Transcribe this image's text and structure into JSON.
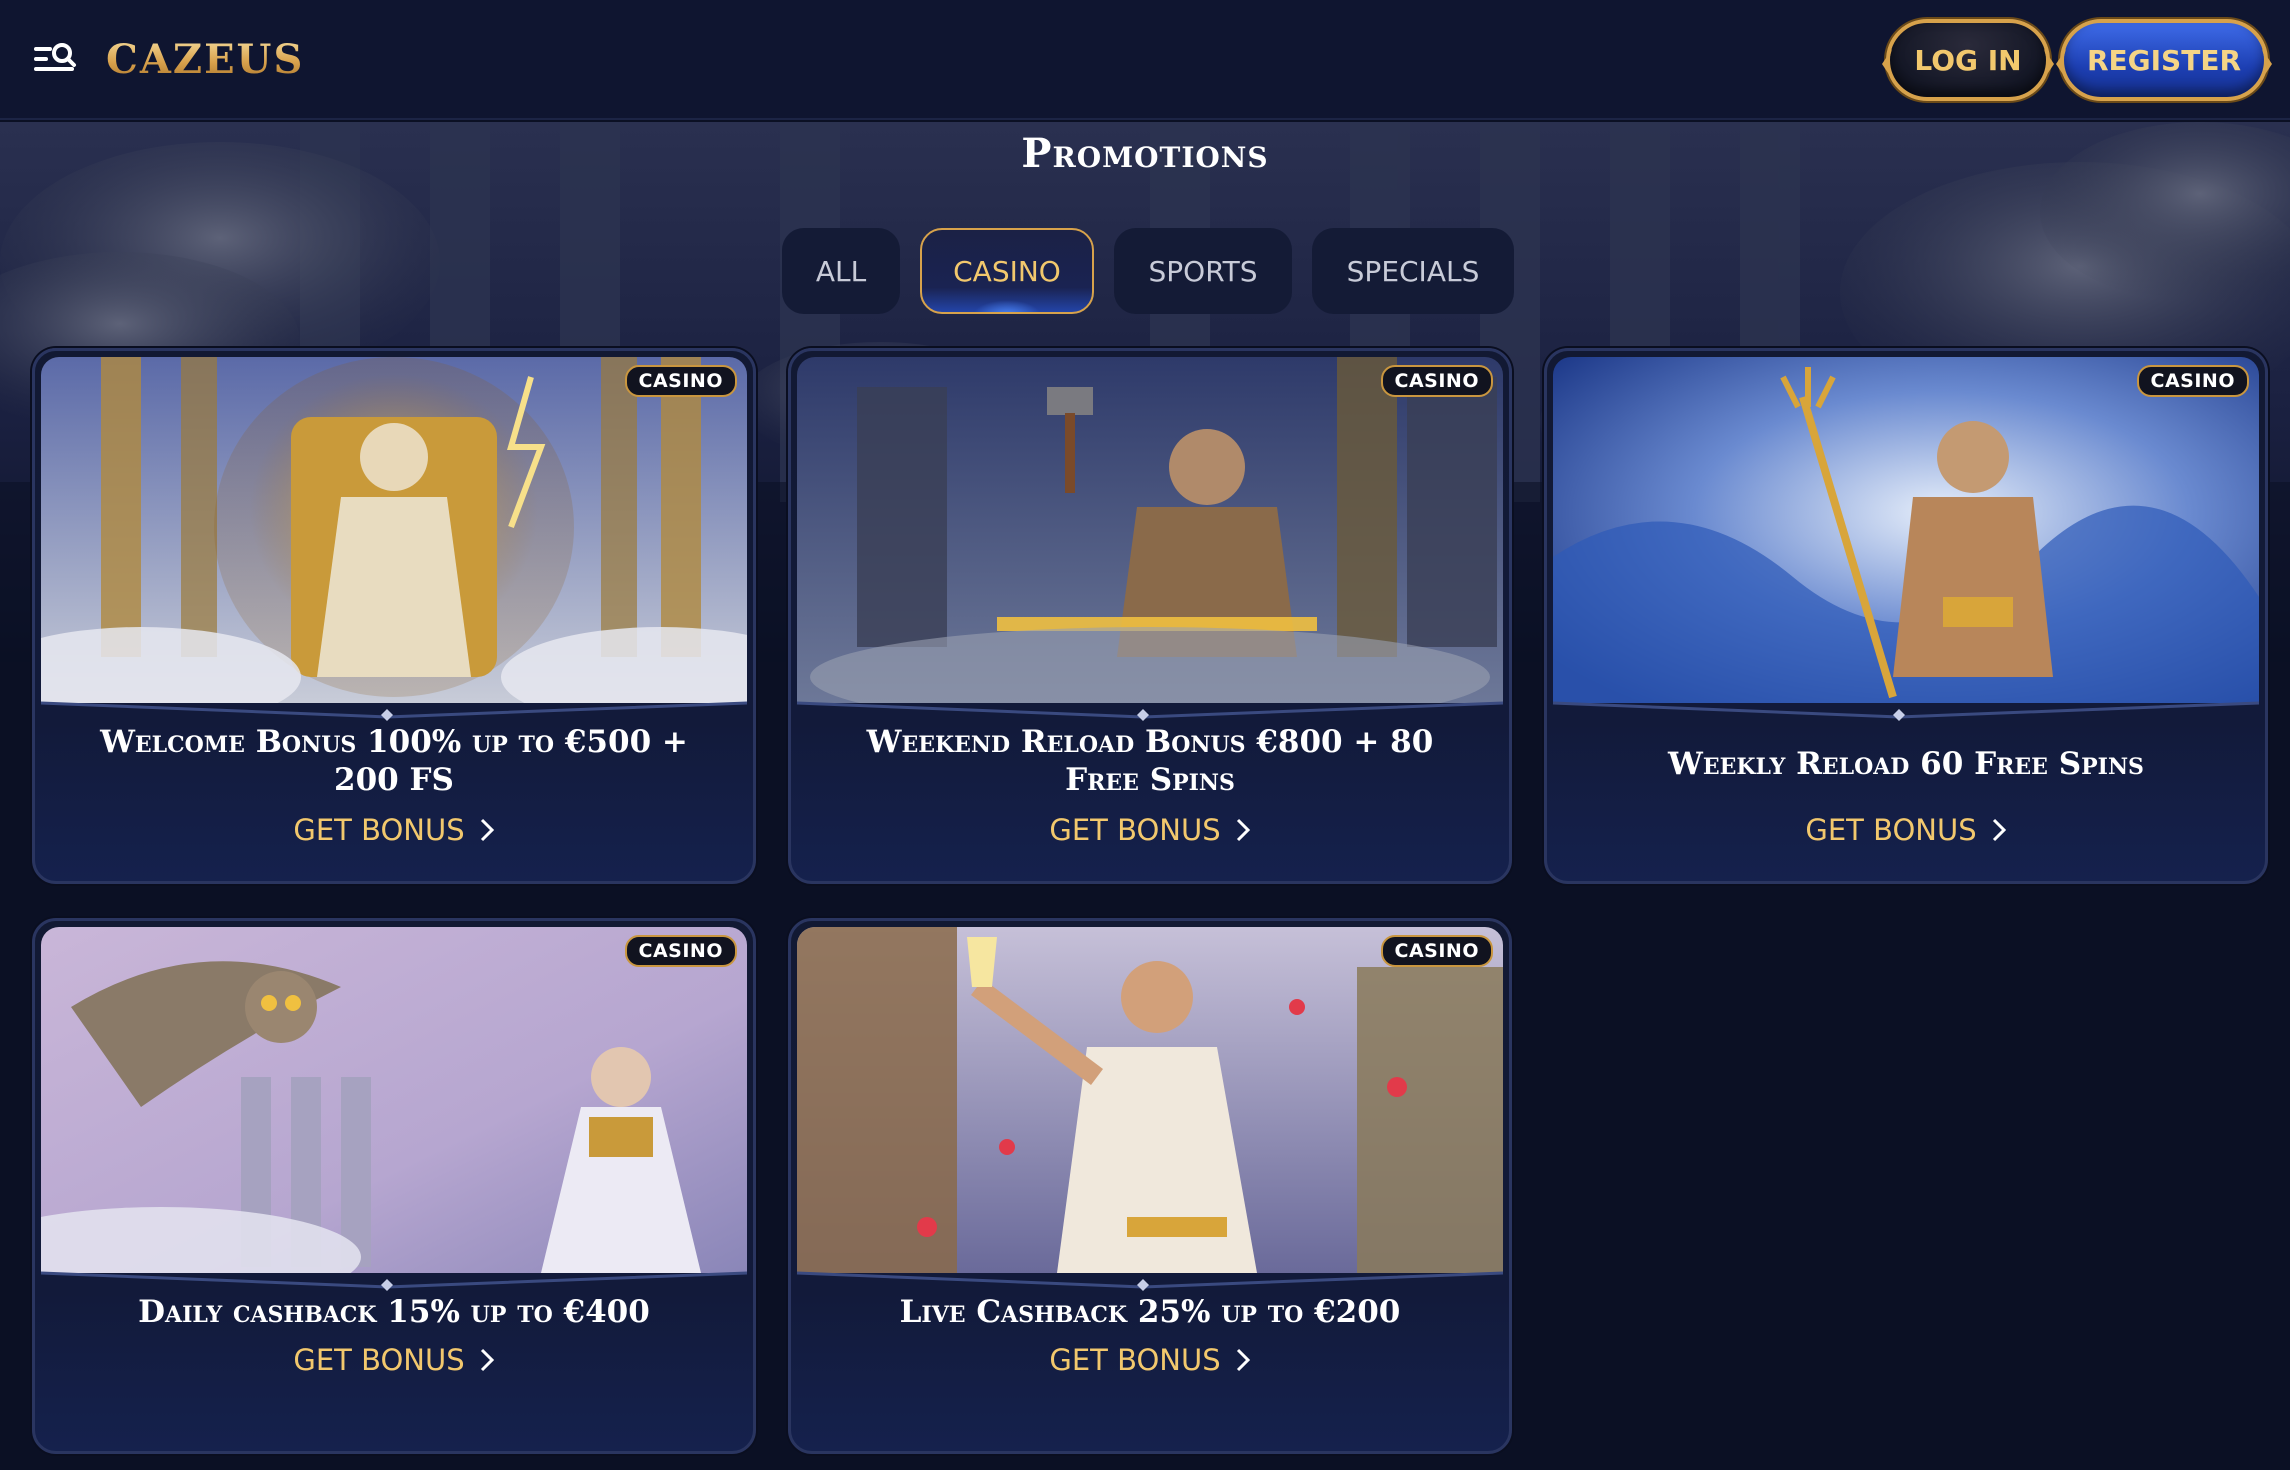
{
  "header": {
    "logo": "CAZEUS",
    "login_label": "LOG IN",
    "register_label": "REGISTER",
    "menu_icon": "menu-search-icon"
  },
  "page_title": "Promotions",
  "tabs": [
    {
      "label": "ALL",
      "active": false
    },
    {
      "label": "CASINO",
      "active": true
    },
    {
      "label": "SPORTS",
      "active": false
    },
    {
      "label": "SPECIALS",
      "active": false
    }
  ],
  "promotions": [
    {
      "badge": "CASINO",
      "title": "Welcome Bonus 100% up to €500 + 200 FS",
      "cta": "GET BONUS",
      "art": "zeus-throne"
    },
    {
      "badge": "CASINO",
      "title": "Weekend Reload Bonus €800 + 80 Free Spins",
      "cta": "GET BONUS",
      "art": "hephaestus-hammer"
    },
    {
      "badge": "CASINO",
      "title": "Weekly Reload 60 Free Spins",
      "cta": "GET BONUS",
      "art": "poseidon-trident"
    },
    {
      "badge": "CASINO",
      "title": "Daily cashback 15% up to €400",
      "cta": "GET BONUS",
      "art": "athena-owl"
    },
    {
      "badge": "CASINO",
      "title": "Live Cashback 25% up to €200",
      "cta": "GET BONUS",
      "art": "dionysus-toast"
    }
  ],
  "colors": {
    "background": "#0b1024",
    "header": "#0f1530",
    "gold": "#f2c86d",
    "register_blue": "#2a55d6",
    "card": "#121933"
  }
}
